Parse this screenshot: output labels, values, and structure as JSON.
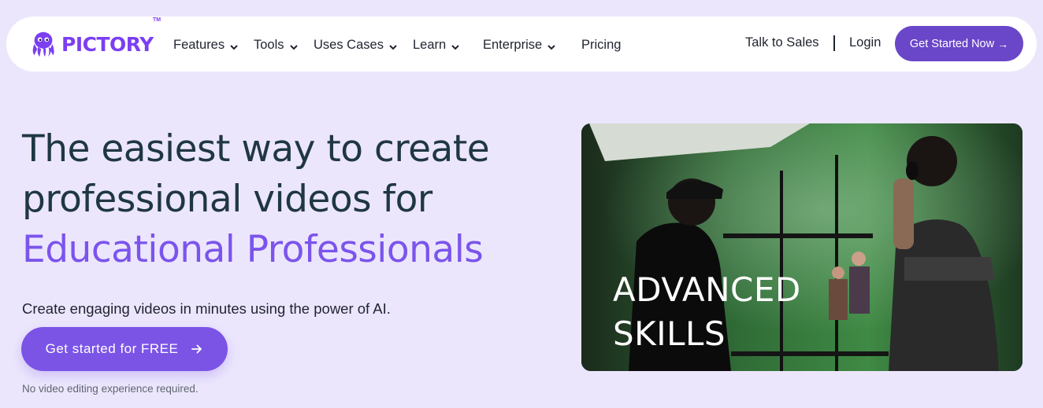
{
  "brand": {
    "name": "PICTORY",
    "trademark": "TM",
    "color": "#7b3ff2"
  },
  "nav": {
    "items": [
      {
        "label": "Features",
        "has_dropdown": true
      },
      {
        "label": "Tools",
        "has_dropdown": true
      },
      {
        "label": "Uses Cases",
        "has_dropdown": true
      },
      {
        "label": "Learn",
        "has_dropdown": true
      },
      {
        "label": "Enterprise",
        "has_dropdown": true
      },
      {
        "label": "Pricing",
        "has_dropdown": false
      }
    ],
    "talk_to_sales": "Talk to Sales",
    "login": "Login",
    "cta": "Get Started Now"
  },
  "hero": {
    "title_line1": "The easiest way to create",
    "title_line2": "professional videos for",
    "title_accent": "Educational Professionals",
    "subtitle": "Create engaging videos in minutes using the power of AI.",
    "cta": "Get started for FREE",
    "note": "No video editing experience required."
  },
  "video": {
    "caption_line1": "ADVANCED",
    "caption_line2": "SKILLS"
  },
  "colors": {
    "background": "#ece6fd",
    "accent": "#7b54ec",
    "button": "#6a46c8",
    "heading": "#1f3743"
  }
}
